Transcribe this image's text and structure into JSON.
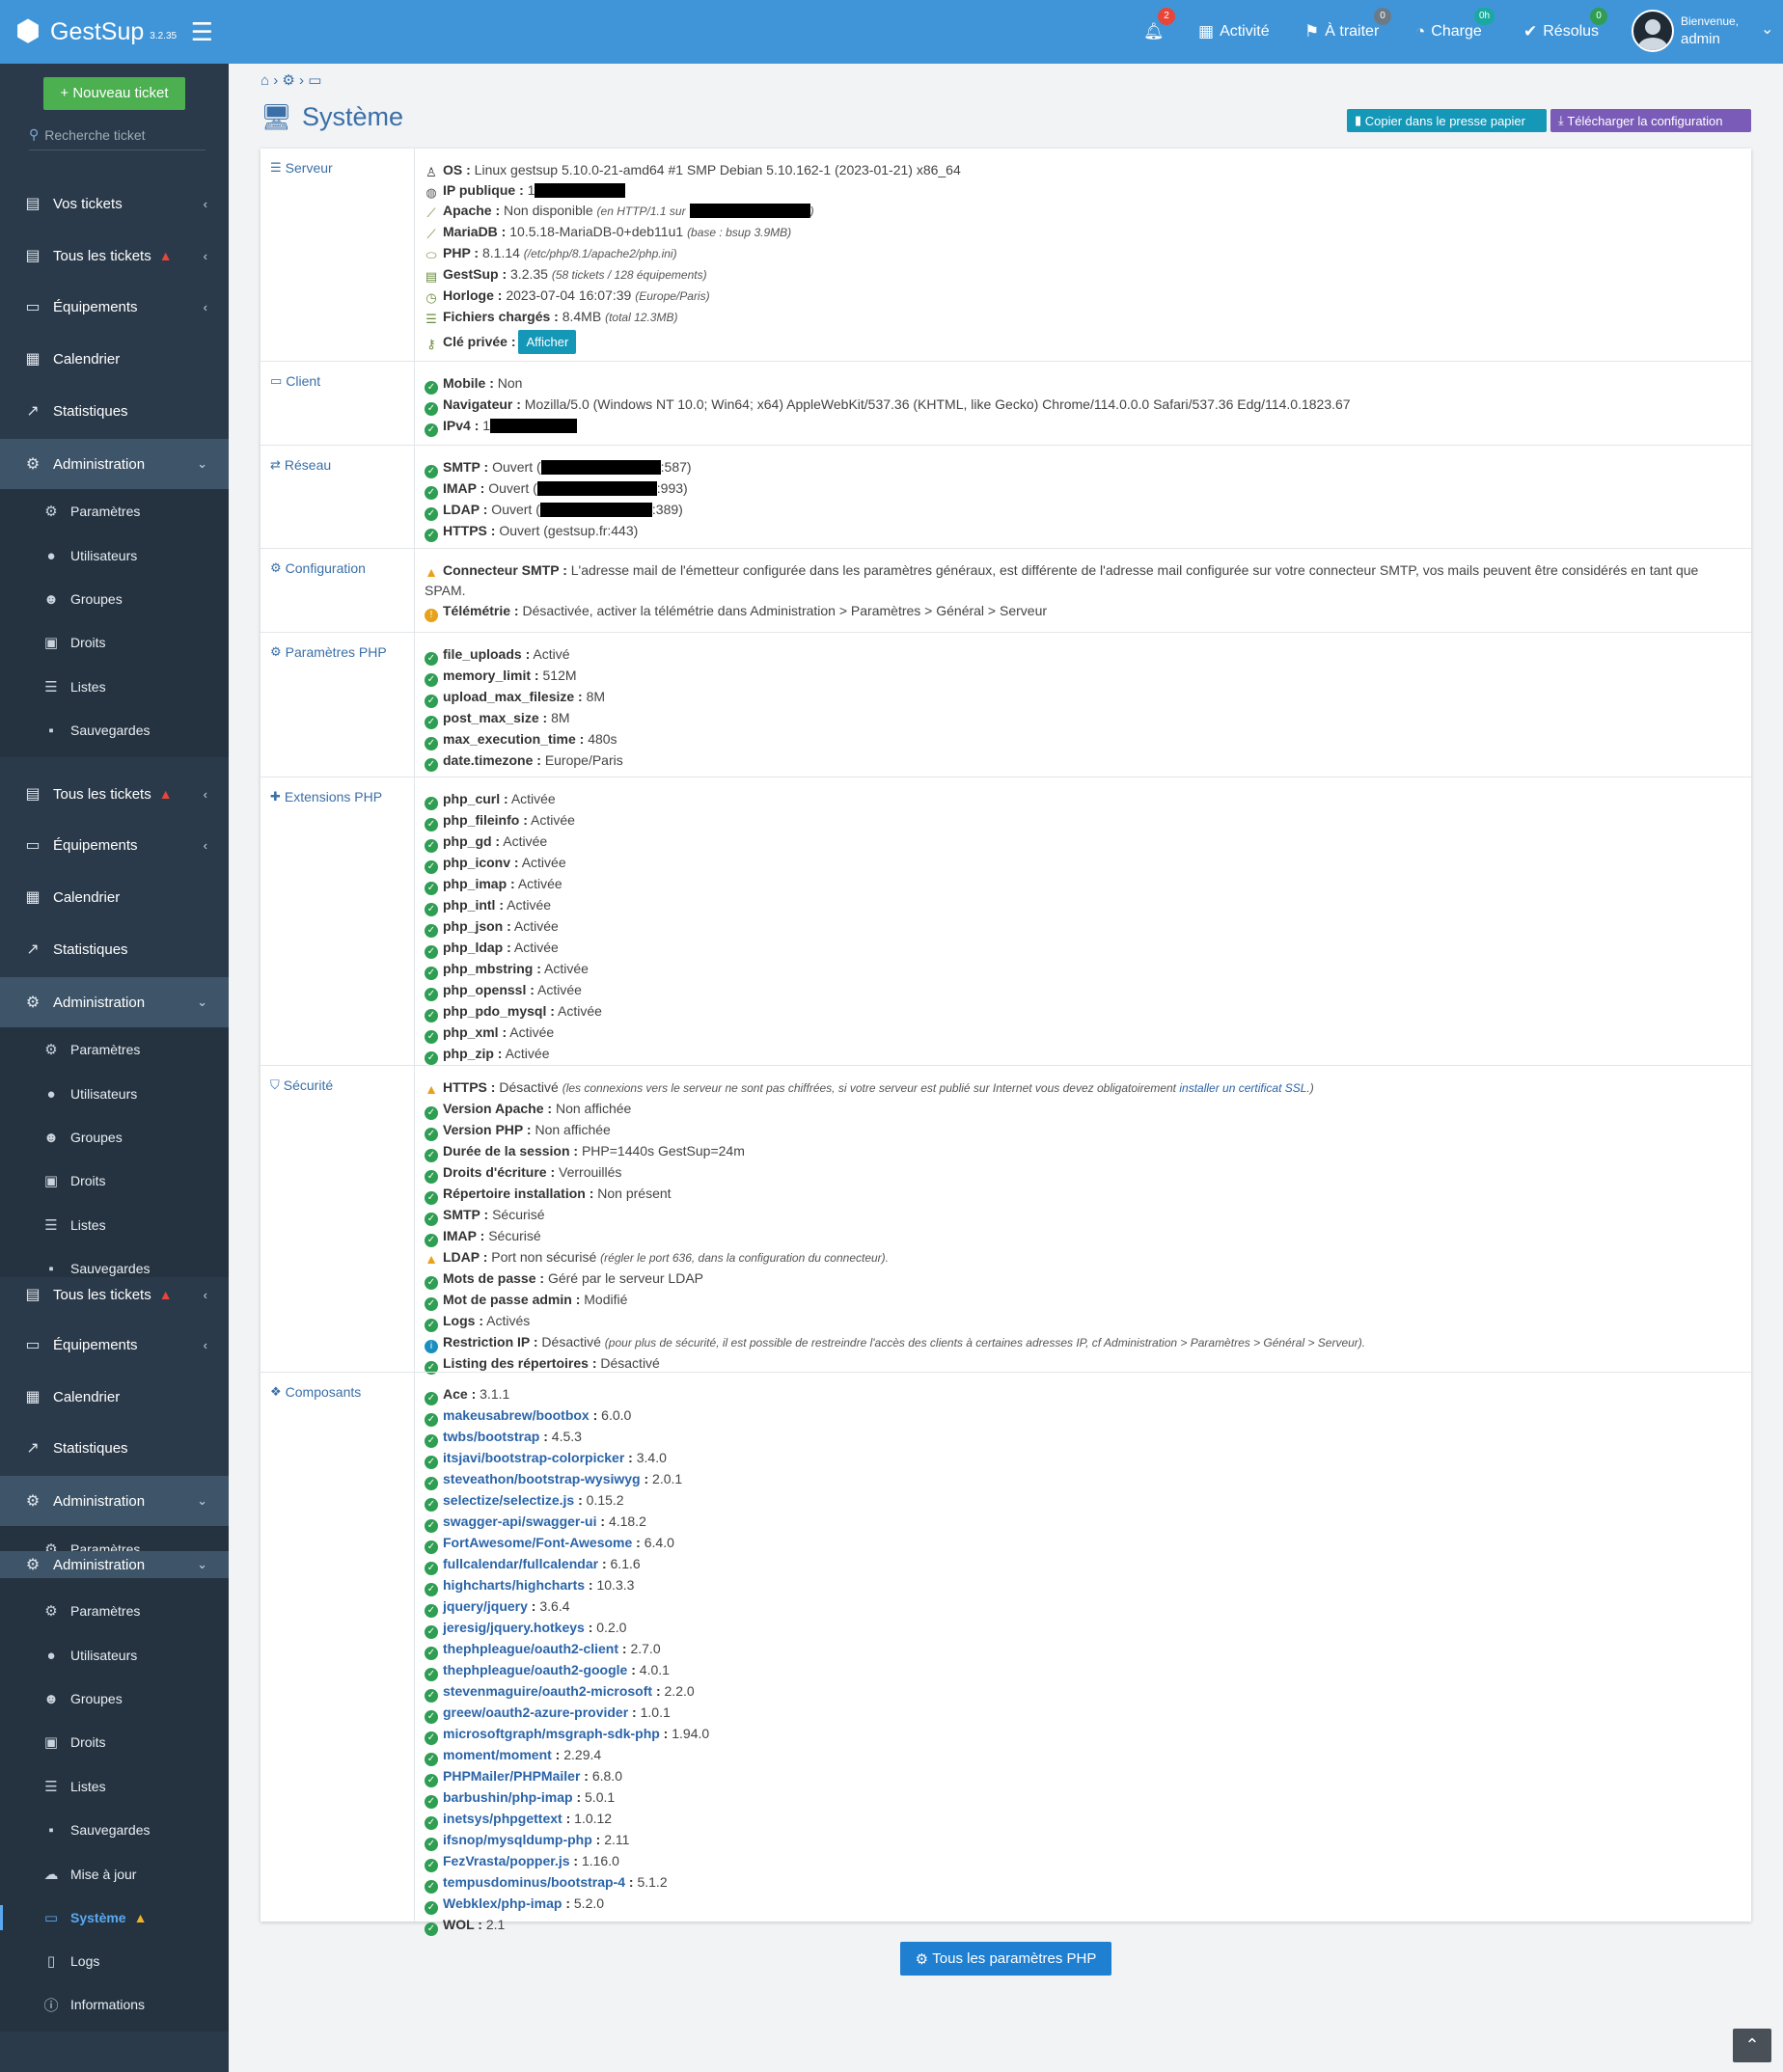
{
  "brand": {
    "name": "GestSup",
    "version": "3.2.35"
  },
  "sidebar": {
    "new_ticket": "+ Nouveau ticket",
    "search_placeholder": "Recherche ticket",
    "menu": {
      "vos_tickets": "Vos tickets",
      "tous_tickets": "Tous les tickets",
      "equipements": "Équipements",
      "calendrier": "Calendrier",
      "statistiques": "Statistiques",
      "administration": "Administration"
    },
    "sub": {
      "parametres": "Paramètres",
      "utilisateurs": "Utilisateurs",
      "groupes": "Groupes",
      "droits": "Droits",
      "listes": "Listes",
      "sauvegardes": "Sauvegardes",
      "mise_a_jour": "Mise à jour",
      "systeme": "Système",
      "logs": "Logs",
      "informations": "Informations"
    }
  },
  "topbar": {
    "notif_count": "2",
    "activite": "Activité",
    "a_traiter": "À traiter",
    "a_traiter_count": "0",
    "charge": "Charge",
    "charge_count": "0h",
    "resolus": "Résolus",
    "resolus_count": "0",
    "welcome": "Bienvenue,",
    "user": "admin"
  },
  "page": {
    "title": "Système",
    "btn_copy": "Copier dans le presse papier",
    "btn_download": "Télécharger la configuration",
    "btn_php": "Tous les paramètres PHP"
  },
  "serveur": {
    "label": "Serveur",
    "os_k": "OS :",
    "os_v": " Linux gestsup 5.10.0-21-amd64 #1 SMP Debian 5.10.162-1 (2023-01-21) x86_64",
    "ip_k": "IP publique :",
    "ip_v": " 1",
    "apache_k": "Apache :",
    "apache_v": " Non disponible ",
    "apache_e1": "(en HTTP/1.1 sur",
    "apache_e2": ")",
    "maria_k": "MariaDB :",
    "maria_v": " 10.5.18-MariaDB-0+deb11u1 ",
    "maria_e": "(base : bsup 3.9MB)",
    "php_k": "PHP :",
    "php_v": " 8.1.14 ",
    "php_e": "(/etc/php/8.1/apache2/php.ini)",
    "gs_k": "GestSup :",
    "gs_v": " 3.2.35 ",
    "gs_e": "(58 tickets / 128 équipements)",
    "hor_k": "Horloge :",
    "hor_v": " 2023-07-04 16:07:39 ",
    "hor_e": "(Europe/Paris)",
    "fich_k": "Fichiers chargés :",
    "fich_v": " 8.4MB ",
    "fich_e": "(total 12.3MB)",
    "cle_k": "Clé privée :",
    "cle_btn": "Afficher"
  },
  "client": {
    "label": "Client",
    "mob_k": "Mobile :",
    "mob_v": " Non",
    "nav_k": "Navigateur :",
    "nav_v": " Mozilla/5.0 (Windows NT 10.0; Win64; x64) AppleWebKit/537.36 (KHTML, like Gecko) Chrome/114.0.0.0 Safari/537.36 Edg/114.0.1823.67",
    "ip_k": "IPv4 :",
    "ip_v": " 1"
  },
  "reseau": {
    "label": "Réseau",
    "smtp_k": "SMTP :",
    "smtp_v": " Ouvert (",
    "smtp_e": ":587)",
    "imap_k": "IMAP :",
    "imap_v": " Ouvert (",
    "imap_e": ":993)",
    "ldap_k": "LDAP :",
    "ldap_v": " Ouvert (",
    "ldap_e": ":389)",
    "https_k": "HTTPS :",
    "https_v": " Ouvert (gestsup.fr:443)"
  },
  "config": {
    "label": "Configuration",
    "smtp_k": "Connecteur SMTP :",
    "smtp_v": " L'adresse mail de l'émetteur configurée dans les paramètres généraux, est différente de l'adresse mail configurée sur votre connecteur SMTP, vos mails peuvent être considérés en tant que SPAM.",
    "tele_k": "Télémétrie :",
    "tele_v": " Désactivée, activer la télémétrie dans Administration > Paramètres > Général > Serveur"
  },
  "phpparams": {
    "label": "Paramètres PHP",
    "items": [
      {
        "k": "file_uploads",
        "v": "Activé"
      },
      {
        "k": "memory_limit",
        "v": "512M"
      },
      {
        "k": "upload_max_filesize",
        "v": "8M"
      },
      {
        "k": "post_max_size",
        "v": "8M"
      },
      {
        "k": "max_execution_time",
        "v": "480s"
      },
      {
        "k": "date.timezone",
        "v": "Europe/Paris"
      }
    ]
  },
  "extensions": {
    "label": "Extensions PHP",
    "items": [
      {
        "k": "php_curl",
        "v": "Activée"
      },
      {
        "k": "php_fileinfo",
        "v": "Activée"
      },
      {
        "k": "php_gd",
        "v": "Activée"
      },
      {
        "k": "php_iconv",
        "v": "Activée"
      },
      {
        "k": "php_imap",
        "v": "Activée"
      },
      {
        "k": "php_intl",
        "v": "Activée"
      },
      {
        "k": "php_json",
        "v": "Activée"
      },
      {
        "k": "php_ldap",
        "v": "Activée"
      },
      {
        "k": "php_mbstring",
        "v": "Activée"
      },
      {
        "k": "php_openssl",
        "v": "Activée"
      },
      {
        "k": "php_pdo_mysql",
        "v": "Activée"
      },
      {
        "k": "php_xml",
        "v": "Activée"
      },
      {
        "k": "php_zip",
        "v": "Activée"
      }
    ]
  },
  "securite": {
    "label": "Sécurité",
    "https_k": "HTTPS :",
    "https_v": " Désactivé ",
    "https_e1": "(les connexions vers le serveur ne sont pas chiffrées, si votre serveur est publié sur Internet vous devez obligatoirement ",
    "https_lk": "installer un certificat SSL",
    "https_e2": ".)",
    "ldap_k": "LDAP :",
    "ldap_v": " Port non sécurisé ",
    "ldap_e": "(régler le port 636, dans la configuration du connecteur).",
    "restr_k": "Restriction IP :",
    "restr_v": " Désactivé ",
    "restr_e": "(pour plus de sécurité, il est possible de restreindre l'accès des clients à certaines adresses IP, cf Administration > Paramètres > Général > Serveur).",
    "items": [
      {
        "k": "Version Apache",
        "v": "Non affichée"
      },
      {
        "k": "Version PHP",
        "v": "Non affichée"
      },
      {
        "k": "Durée de la session",
        "v": "PHP=1440s GestSup=24m"
      },
      {
        "k": "Droits d'écriture",
        "v": "Verrouillés"
      },
      {
        "k": "Répertoire installation",
        "v": "Non présent"
      },
      {
        "k": "SMTP",
        "v": "Sécurisé"
      },
      {
        "k": "IMAP",
        "v": "Sécurisé"
      }
    ],
    "items2": [
      {
        "k": "Mots de passe",
        "v": "Géré par le serveur LDAP"
      },
      {
        "k": "Mot de passe admin",
        "v": "Modifié"
      },
      {
        "k": "Logs",
        "v": "Activés"
      }
    ],
    "list_k": "Listing des répertoires :",
    "list_v": " Désactivé"
  },
  "composants": {
    "label": "Composants",
    "first_k": "Ace",
    "first_v": "3.1.1",
    "items": [
      {
        "k": "makeusabrew/bootbox",
        "v": "6.0.0"
      },
      {
        "k": "twbs/bootstrap",
        "v": "4.5.3"
      },
      {
        "k": "itsjavi/bootstrap-colorpicker",
        "v": "3.4.0"
      },
      {
        "k": "steveathon/bootstrap-wysiwyg",
        "v": "2.0.1"
      },
      {
        "k": "selectize/selectize.js",
        "v": "0.15.2"
      },
      {
        "k": "swagger-api/swagger-ui",
        "v": "4.18.2"
      },
      {
        "k": "FortAwesome/Font-Awesome",
        "v": "6.4.0"
      },
      {
        "k": "fullcalendar/fullcalendar",
        "v": "6.1.6"
      },
      {
        "k": "highcharts/highcharts",
        "v": "10.3.3"
      },
      {
        "k": "jquery/jquery",
        "v": "3.6.4"
      },
      {
        "k": "jeresig/jquery.hotkeys",
        "v": "0.2.0"
      },
      {
        "k": "thephpleague/oauth2-client",
        "v": "2.7.0"
      },
      {
        "k": "thephpleague/oauth2-google",
        "v": "4.0.1"
      },
      {
        "k": "stevenmaguire/oauth2-microsoft",
        "v": "2.2.0"
      },
      {
        "k": "greew/oauth2-azure-provider",
        "v": "1.0.1"
      },
      {
        "k": "microsoftgraph/msgraph-sdk-php",
        "v": "1.94.0"
      },
      {
        "k": "moment/moment",
        "v": "2.29.4"
      },
      {
        "k": "PHPMailer/PHPMailer",
        "v": "6.8.0"
      },
      {
        "k": "barbushin/php-imap",
        "v": "5.0.1"
      },
      {
        "k": "inetsys/phpgettext",
        "v": "1.0.12"
      },
      {
        "k": "ifsnop/mysqldump-php",
        "v": "2.11"
      },
      {
        "k": "FezVrasta/popper.js",
        "v": "1.16.0"
      },
      {
        "k": "tempusdominus/bootstrap-4",
        "v": "5.1.2"
      },
      {
        "k": "Webklex/php-imap",
        "v": "5.2.0"
      }
    ],
    "last_k": "WOL",
    "last_v": "2.1"
  }
}
